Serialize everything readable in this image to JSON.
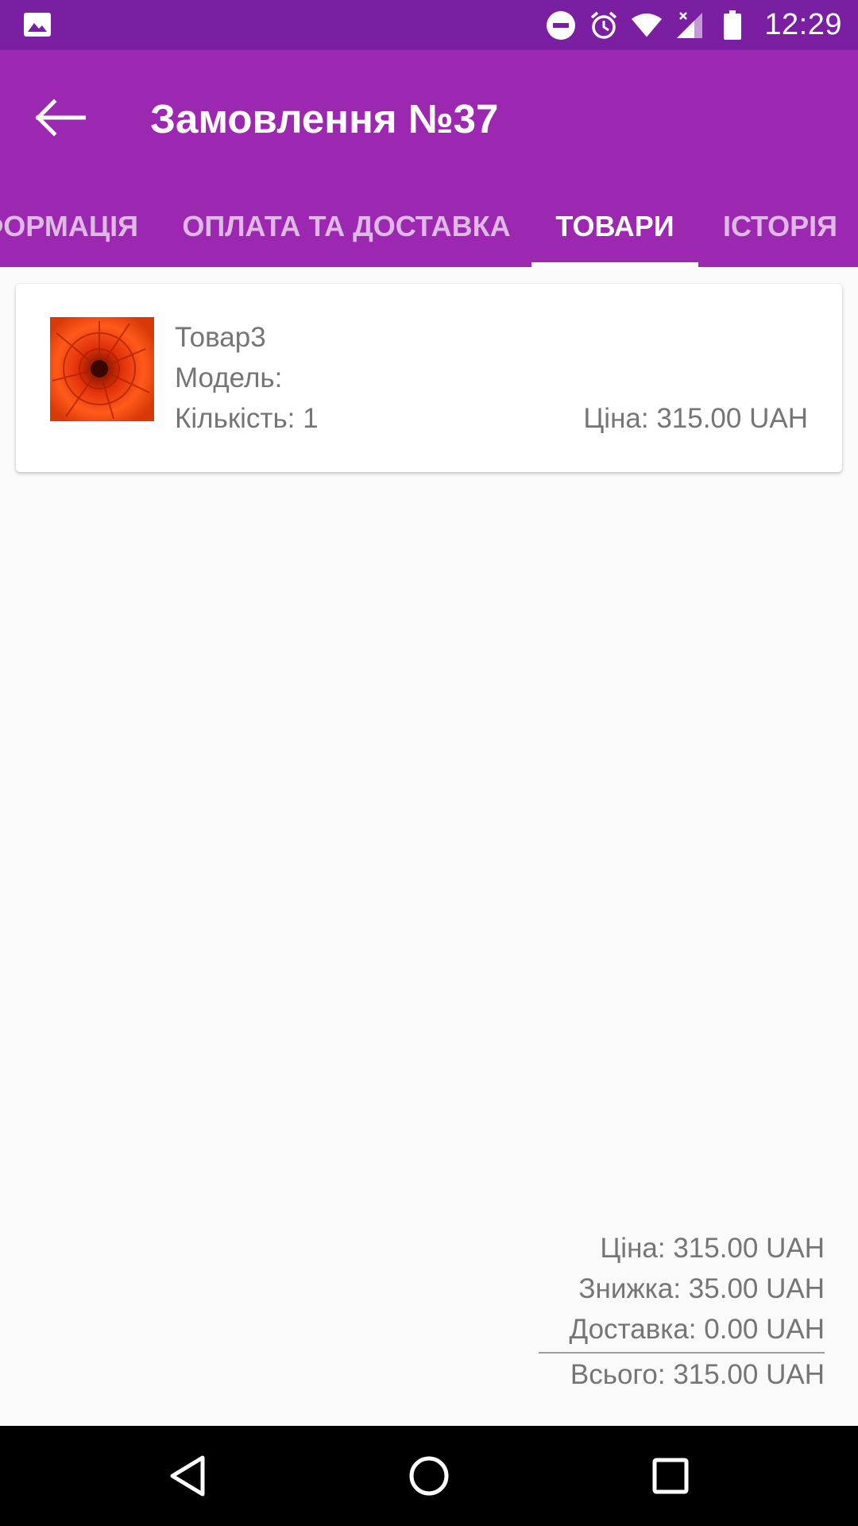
{
  "status_bar": {
    "time": "12:29",
    "icons": [
      "image-icon",
      "do-not-disturb-icon",
      "alarm-icon",
      "wifi-icon",
      "signal-icon",
      "battery-icon"
    ]
  },
  "app_bar": {
    "title": "Замовлення №37",
    "back_icon": "arrow-back-icon",
    "color": "#9c27b0",
    "status_color": "#7b1fa2"
  },
  "tabs": [
    {
      "label": "ІНФОРМАЦІЯ",
      "visible_text": "ФОРМАЦІЯ"
    },
    {
      "label": "ОПЛАТА ТА ДОСТАВКА"
    },
    {
      "label": "ТОВАРИ",
      "active": true
    },
    {
      "label": "ІСТОРІЯ"
    }
  ],
  "product": {
    "name": "Товар3",
    "model": "Модель:",
    "quantity": "Кількість: 1",
    "price": "Ціна: 315.00 UAH"
  },
  "totals": {
    "price": "Ціна: 315.00 UAH",
    "discount": "Знижка: 35.00 UAH",
    "delivery": "Доставка: 0.00 UAH",
    "total": "Всього: 315.00 UAH"
  },
  "nav_bar": {
    "icons": [
      "nav-back-icon",
      "nav-home-icon",
      "nav-recents-icon"
    ]
  }
}
